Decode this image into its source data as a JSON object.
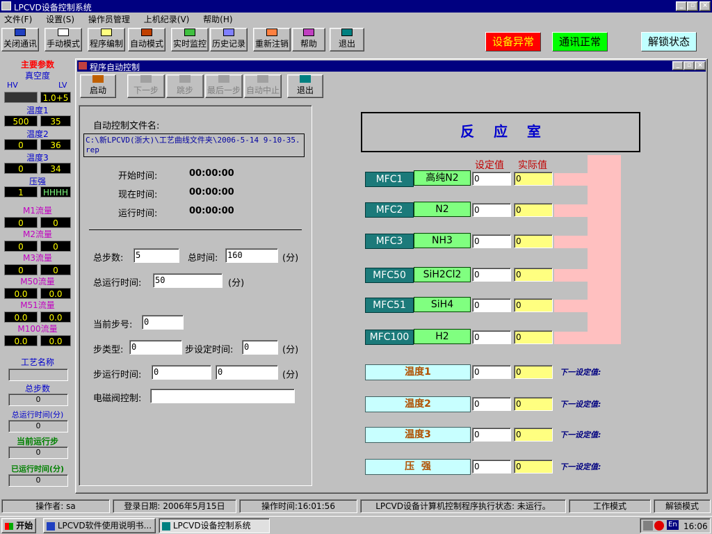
{
  "window": {
    "title": "LPCVD设备控制系统",
    "min": "_",
    "max": "▫",
    "close": "×"
  },
  "menu": [
    "文件(F)",
    "设置(S)",
    "操作员管理",
    "上机纪录(V)",
    "帮助(H)"
  ],
  "toolbar": [
    "关闭通讯",
    "手动模式",
    "程序编制",
    "自动模式",
    "实时监控",
    "历史记录",
    "重新注销",
    "帮助",
    "退出"
  ],
  "status_buttons": {
    "device": "设备异常",
    "comm": "通讯正常",
    "unlock": "解锁状态"
  },
  "colors": {
    "title_blue": "#000080",
    "device_red": "#ff0000",
    "comm_green": "#00ff00",
    "unlock_cyan": "#c0ffff",
    "mfc_teal": "#1c7a7a",
    "gas_green": "#80ff80"
  },
  "left": {
    "title": "主要参数",
    "vac": {
      "label": "真空度",
      "hv": "HV",
      "lv": "LV",
      "hv_val": "",
      "lv_val": "1.0+5"
    },
    "temps": [
      {
        "label": "温度1",
        "a": "500",
        "b": "35"
      },
      {
        "label": "温度2",
        "a": "0",
        "b": "36"
      },
      {
        "label": "温度3",
        "a": "0",
        "b": "34"
      }
    ],
    "pressure": {
      "label": "压强",
      "a": "1",
      "b": "HHHH"
    },
    "flows": [
      {
        "label": "M1流量",
        "a": "0",
        "b": "0"
      },
      {
        "label": "M2流量",
        "a": "0",
        "b": "0"
      },
      {
        "label": "M3流量",
        "a": "0",
        "b": "0"
      },
      {
        "label": "M50流量",
        "a": "0.0",
        "b": "0.0"
      },
      {
        "label": "M51流量",
        "a": "0.0",
        "b": "0.0"
      },
      {
        "label": "M100流量",
        "a": "0.0",
        "b": "0.0"
      }
    ],
    "process_name_label": "工艺名称",
    "process_name": "",
    "total_steps_label": "总步数",
    "total_steps": "0",
    "total_run_label": "总运行时间(分)",
    "total_run": "0",
    "cur_step_label": "当前运行步",
    "cur_step": "0",
    "elapsed_label": "已运行时间(分)",
    "elapsed": "0"
  },
  "inner": {
    "title": "程序自动控制",
    "toolbar": [
      "启动",
      "下一步",
      "跳步",
      "最后一步",
      "自动中止",
      "退出"
    ],
    "file_label": "自动控制文件名:",
    "file_path": "C:\\新LPCVD(浙大)\\工艺曲线文件夹\\2006-5-14 9-10-35.rep",
    "start_label": "开始时间:",
    "start_val": "00:00:00",
    "now_label": "现在时间:",
    "now_val": "00:00:00",
    "run_label": "运行时间:",
    "run_val": "00:00:00",
    "steps_label": "总步数:",
    "steps_val": "5",
    "total_time_label": "总时间:",
    "total_time_val": "160",
    "unit": "(分)",
    "total_run_label": "总运行时间:",
    "total_run_val": "50",
    "cur_step_label": "当前步号:",
    "cur_step_val": "0",
    "step_type_label": "步类型:",
    "step_type_val": "0",
    "step_set_label": "步设定时间:",
    "step_set_val": "0",
    "step_run_label": "步运行时间:",
    "step_run_a": "0",
    "step_run_b": "0",
    "valve_label": "电磁阀控制:",
    "valve_val": ""
  },
  "chamber": {
    "title": "反    应    室",
    "set_header": "设定值",
    "act_header": "实际值",
    "mfcs": [
      {
        "id": "MFC1",
        "gas": "高纯N2",
        "set": "0",
        "act": "0"
      },
      {
        "id": "MFC2",
        "gas": "N2",
        "set": "0",
        "act": "0"
      },
      {
        "id": "MFC3",
        "gas": "NH3",
        "set": "0",
        "act": "0"
      },
      {
        "id": "MFC50",
        "gas": "SiH2Cl2",
        "set": "0",
        "act": "0"
      },
      {
        "id": "MFC51",
        "gas": "SiH4",
        "set": "0",
        "act": "0"
      },
      {
        "id": "MFC100",
        "gas": "H2",
        "set": "0",
        "act": "0"
      }
    ],
    "temps": [
      {
        "label": "温度1",
        "set": "0",
        "act": "0",
        "next": "下一设定值:"
      },
      {
        "label": "温度2",
        "set": "0",
        "act": "0",
        "next": "下一设定值:"
      },
      {
        "label": "温度3",
        "set": "0",
        "act": "0",
        "next": "下一设定值:"
      },
      {
        "label": "压  强",
        "set": "0",
        "act": "0",
        "next": "下一设定值:"
      }
    ]
  },
  "statusbar": [
    "操作者: sa",
    "登录日期: 2006年5月15日",
    "操作时间:16:01:56",
    "LPCVD设备计算机控制程序执行状态: 未运行。",
    "工作模式",
    "解锁模式"
  ],
  "taskbar": {
    "start": "开始",
    "tasks": [
      "LPCVD软件使用说明书...",
      "LPCVD设备控制系统"
    ],
    "lang": "En",
    "time": "16:06"
  }
}
